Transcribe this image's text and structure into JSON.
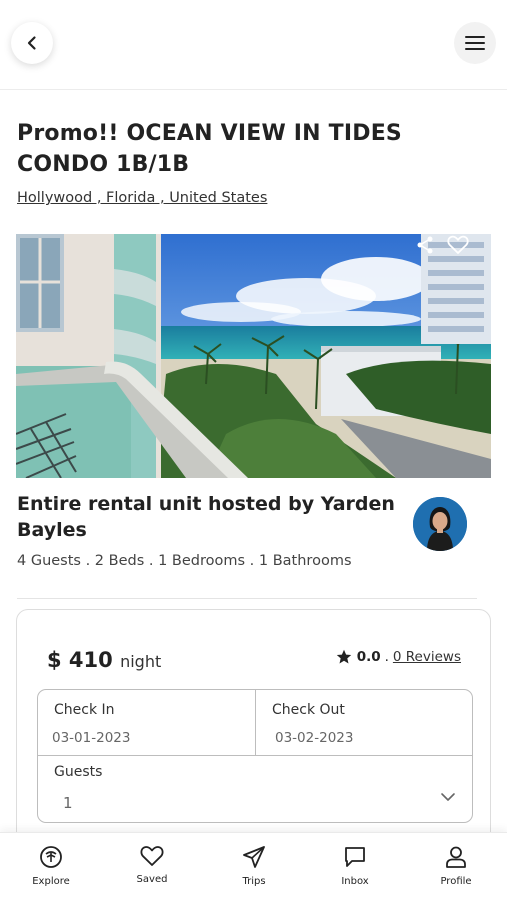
{
  "header": {
    "back_icon": "chevron-left-icon",
    "menu_icon": "hamburger-menu-icon"
  },
  "listing": {
    "title": "Promo!! OCEAN VIEW IN TIDES CONDO 1B/1B",
    "location": "Hollywood , Florida , United States",
    "photo_actions": {
      "share_icon": "share-icon",
      "favorite_icon": "heart-icon"
    }
  },
  "host": {
    "heading": "Entire rental unit hosted by Yarden Bayles",
    "specs": "4 Guests . 2 Beds . 1 Bedrooms . 1 Bathrooms"
  },
  "booking": {
    "price": "$ 410",
    "price_unit": "night",
    "rating_score": "0.0",
    "rating_separator": ".",
    "reviews_label": "0 Reviews",
    "check_in": {
      "label": "Check In",
      "value": "03-01-2023"
    },
    "check_out": {
      "label": "Check Out",
      "value": "03-02-2023"
    },
    "guests": {
      "label": "Guests",
      "value": "1"
    }
  },
  "nav": {
    "items": [
      {
        "label": "Explore",
        "icon": "explore-icon"
      },
      {
        "label": "Saved",
        "icon": "heart-icon"
      },
      {
        "label": "Trips",
        "icon": "paper-plane-icon"
      },
      {
        "label": "Inbox",
        "icon": "chat-bubble-icon"
      },
      {
        "label": "Profile",
        "icon": "user-icon"
      }
    ]
  }
}
